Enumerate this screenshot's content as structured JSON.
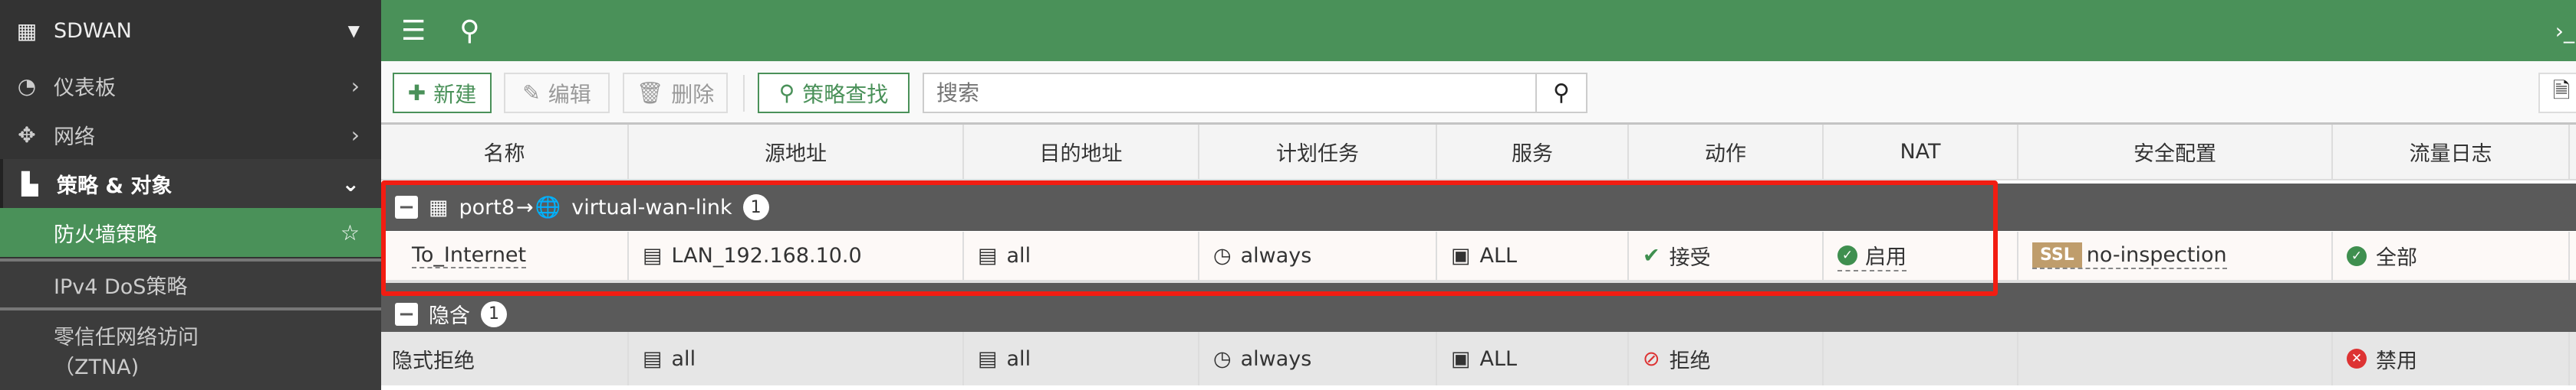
{
  "sidebar": {
    "title": "SDWAN",
    "items": [
      {
        "label": "仪表板",
        "icon": "dashboard-icon"
      },
      {
        "label": "网络",
        "icon": "move-icon"
      },
      {
        "label": "策略 & 对象",
        "icon": "policy-icon"
      },
      {
        "label": "防火墙策略"
      },
      {
        "label": "IPv4 DoS策略"
      },
      {
        "label": "零信任网络访问",
        "label2": "（ZTNA)"
      }
    ]
  },
  "toolbar": {
    "new": "新建",
    "edit": "编辑",
    "delete": "删除",
    "policy_lookup": "策略查找",
    "search_placeholder": "搜索"
  },
  "table": {
    "columns": [
      "名称",
      "源地址",
      "目的地址",
      "计划任务",
      "服务",
      "动作",
      "NAT",
      "安全配置",
      "流量日志"
    ],
    "groups": [
      {
        "from": "port8",
        "arrow": "→",
        "to": "virtual-wan-link",
        "count": "1",
        "rows": [
          {
            "name": "To_Internet",
            "src": "LAN_192.168.10.0",
            "dst": "all",
            "schedule": "always",
            "service": "ALL",
            "action": "接受",
            "nat": "启用",
            "ssl_badge": "SSL",
            "security": "no-inspection",
            "log": "全部"
          }
        ]
      },
      {
        "label": "隐含",
        "count": "1",
        "rows": [
          {
            "name": "隐式拒绝",
            "src": "all",
            "dst": "all",
            "schedule": "always",
            "service": "ALL",
            "action": "拒绝",
            "log": "禁用"
          }
        ]
      }
    ]
  },
  "colors": {
    "green": "#4a9159",
    "highlight": "#f21d12",
    "group": "#5a5a5a"
  }
}
